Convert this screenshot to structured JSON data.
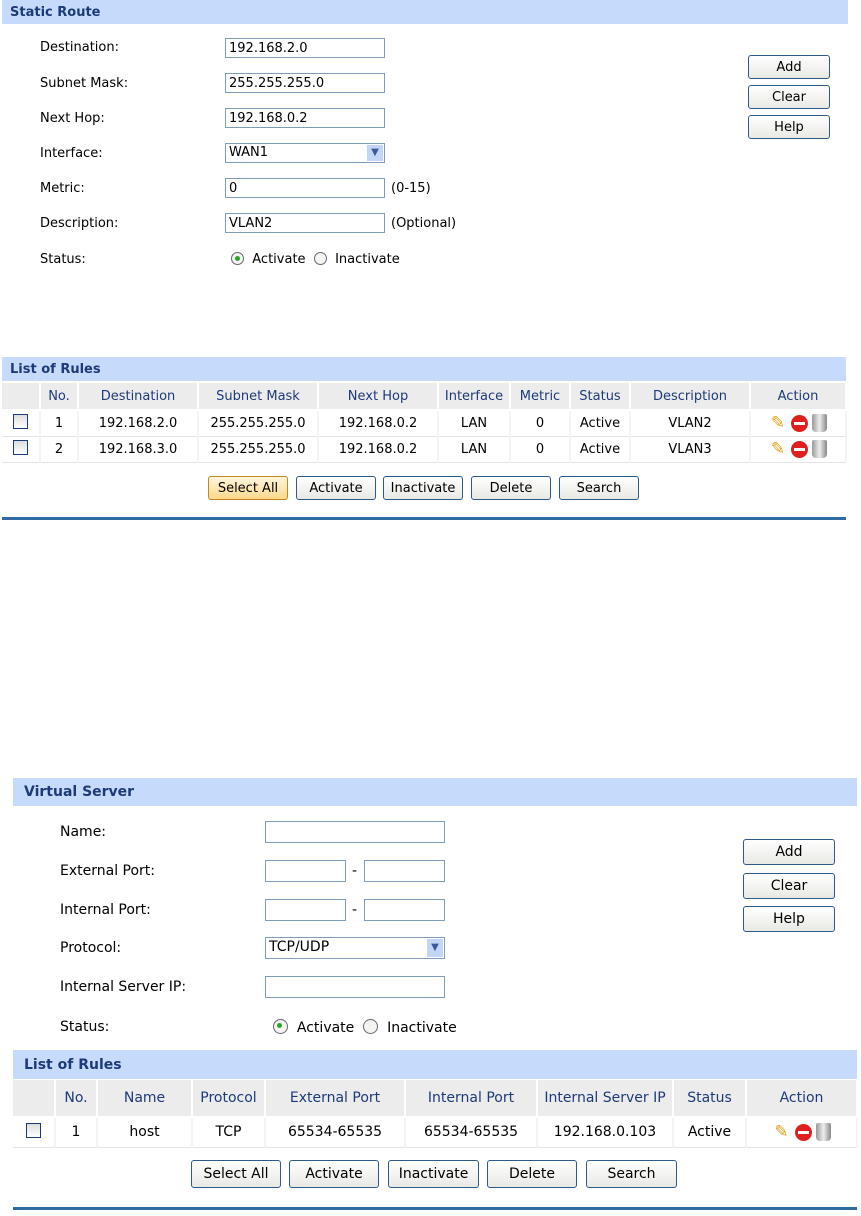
{
  "static_route": {
    "title": "Static Route",
    "fields": {
      "destination_label": "Destination:",
      "destination": "192.168.2.0",
      "mask_label": "Subnet Mask:",
      "mask": "255.255.255.0",
      "nexthop_label": "Next Hop:",
      "nexthop": "192.168.0.2",
      "interface_label": "Interface:",
      "interface": "WAN1",
      "metric_label": "Metric:",
      "metric": "0",
      "metric_hint": "(0-15)",
      "desc_label": "Description:",
      "desc": "VLAN2",
      "desc_hint": "(Optional)",
      "status_label": "Status:",
      "activate": "Activate",
      "inactivate": "Inactivate"
    },
    "buttons": {
      "add": "Add",
      "clear": "Clear",
      "help": "Help"
    },
    "list_title": "List of Rules",
    "columns": [
      "No.",
      "Destination",
      "Subnet Mask",
      "Next Hop",
      "Interface",
      "Metric",
      "Status",
      "Description",
      "Action"
    ],
    "rows": [
      [
        "1",
        "192.168.2.0",
        "255.255.255.0",
        "192.168.0.2",
        "LAN",
        "0",
        "Active",
        "VLAN2"
      ],
      [
        "2",
        "192.168.3.0",
        "255.255.255.0",
        "192.168.0.2",
        "LAN",
        "0",
        "Active",
        "VLAN3"
      ]
    ],
    "list_buttons": {
      "select_all": "Select All",
      "activate": "Activate",
      "inactivate": "Inactivate",
      "delete": "Delete",
      "search": "Search"
    }
  },
  "virtual_server": {
    "title": "Virtual Server",
    "fields": {
      "name_label": "Name:",
      "ext_label": "External Port:",
      "int_label": "Internal Port:",
      "protocol_label": "Protocol:",
      "protocol": "TCP/UDP",
      "ip_label": "Internal Server IP:",
      "status_label": "Status:",
      "activate": "Activate",
      "inactivate": "Inactivate",
      "dash": "-"
    },
    "buttons": {
      "add": "Add",
      "clear": "Clear",
      "help": "Help"
    },
    "list_title": "List of Rules",
    "columns": [
      "No.",
      "Name",
      "Protocol",
      "External Port",
      "Internal Port",
      "Internal Server IP",
      "Status",
      "Action"
    ],
    "rows": [
      [
        "1",
        "host",
        "TCP",
        "65534-65535",
        "65534-65535",
        "192.168.0.103",
        "Active"
      ]
    ],
    "list_buttons": {
      "select_all": "Select All",
      "activate": "Activate",
      "inactivate": "Inactivate",
      "delete": "Delete",
      "search": "Search"
    }
  }
}
